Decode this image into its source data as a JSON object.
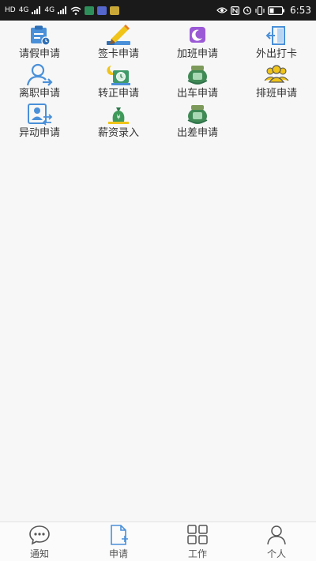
{
  "status_bar": {
    "left_labels": [
      "HD",
      "4G",
      "4G"
    ],
    "time": "6:53",
    "battery_color": "#ffffff",
    "app_icon_colors": [
      "#2f8f5b",
      "#5566cc",
      "#c9a838"
    ]
  },
  "apps": [
    {
      "label": "请假申请",
      "icon": "leave-calendar-icon"
    },
    {
      "label": "签卡申请",
      "icon": "sign-card-pencil-icon"
    },
    {
      "label": "加班申请",
      "icon": "overtime-moon-icon"
    },
    {
      "label": "外出打卡",
      "icon": "door-exit-icon"
    },
    {
      "label": "离职申请",
      "icon": "resign-person-icon"
    },
    {
      "label": "转正申请",
      "icon": "regular-clock-icon"
    },
    {
      "label": "出车申请",
      "icon": "vehicle-jar-icon"
    },
    {
      "label": "排班申请",
      "icon": "schedule-group-icon"
    },
    {
      "label": "异动申请",
      "icon": "transfer-person-icon"
    },
    {
      "label": "薪资录入",
      "icon": "salary-moneybag-icon"
    },
    {
      "label": "出差申请",
      "icon": "business-trip-jar-icon"
    }
  ],
  "tabs": [
    {
      "label": "通知",
      "icon": "chat-bubble-icon"
    },
    {
      "label": "申请",
      "icon": "document-add-icon"
    },
    {
      "label": "工作",
      "icon": "grid-icon"
    },
    {
      "label": "个人",
      "icon": "person-icon"
    }
  ],
  "colors": {
    "accent_blue": "#4a90d9",
    "purple": "#8b5cf6",
    "green_jar": "#3f8a55",
    "yellow": "#f0c419",
    "text": "#333333"
  }
}
